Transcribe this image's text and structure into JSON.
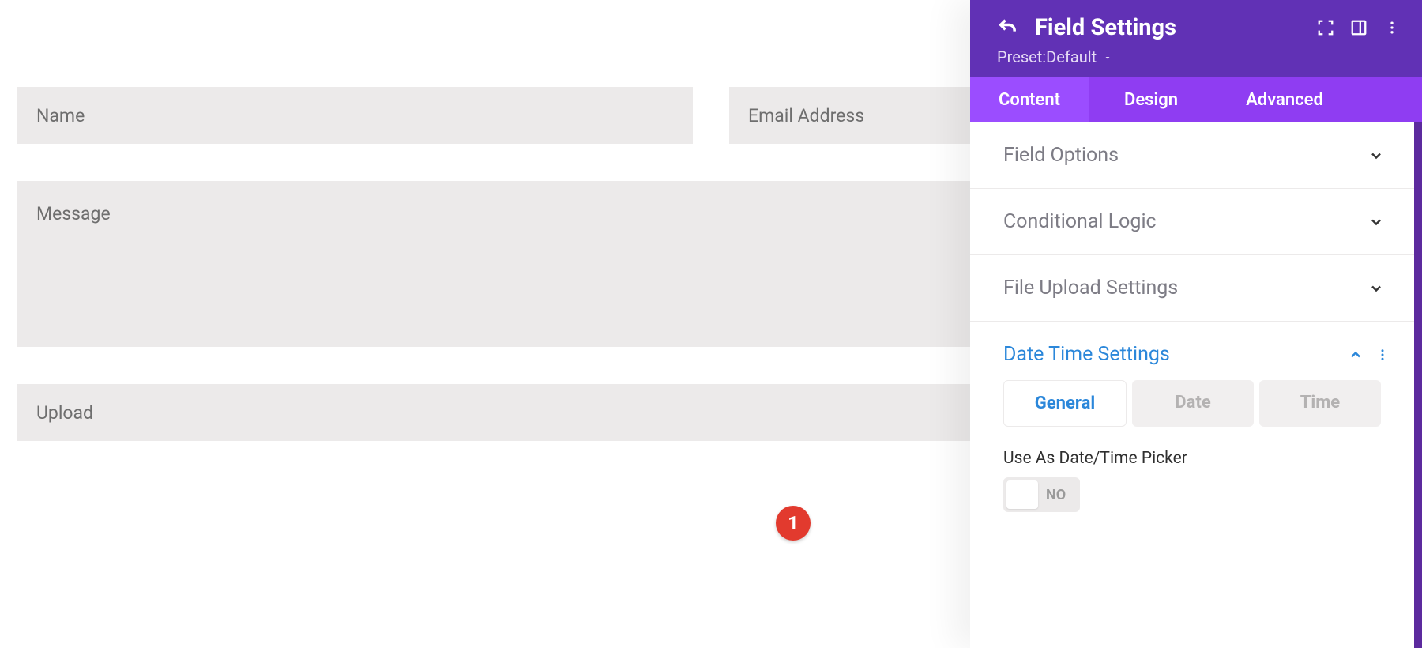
{
  "form": {
    "name_placeholder": "Name",
    "email_placeholder": "Email Address",
    "message_placeholder": "Message",
    "upload_placeholder": "Upload"
  },
  "panel": {
    "title": "Field Settings",
    "preset_prefix": "Preset: ",
    "preset_value": "Default",
    "tabs": {
      "content": "Content",
      "design": "Design",
      "advanced": "Advanced"
    },
    "sections": {
      "field_options": "Field Options",
      "conditional_logic": "Conditional Logic",
      "file_upload_settings": "File Upload Settings",
      "date_time_settings": "Date Time Settings"
    },
    "subtabs": {
      "general": "General",
      "date": "Date",
      "time": "Time"
    },
    "option": {
      "use_as_datetime_label": "Use As Date/Time Picker",
      "toggle_state": "NO"
    }
  },
  "marker": {
    "number": "1"
  }
}
